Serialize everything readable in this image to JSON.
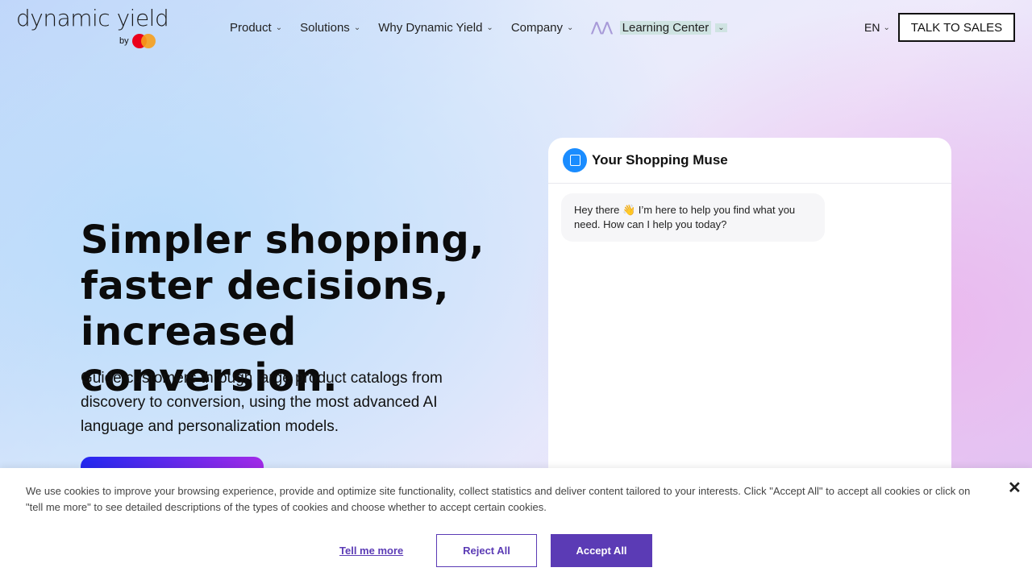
{
  "logo": {
    "name": "dynamic yield",
    "by": "by"
  },
  "nav": [
    {
      "label": "Product"
    },
    {
      "label": "Solutions"
    },
    {
      "label": "Why Dynamic Yield"
    },
    {
      "label": "Company"
    },
    {
      "label": "Learning Center"
    }
  ],
  "header": {
    "lang": "EN",
    "talk": "TALK TO SALES"
  },
  "hero": {
    "title": "Simpler shopping, faster decisions, increased conversion.",
    "subtitle": "Guide customers through large product catalogs from discovery to conversion, using the most advanced AI language and personalization models."
  },
  "chat": {
    "title": "Your Shopping Muse",
    "message": "Hey there 👋 I’m here to help you find what you need. How can I help you today?"
  },
  "cookie": {
    "text": "We use cookies to improve your browsing experience, provide and optimize site functionality, collect statistics and deliver content tailored to your interests. Click \"Accept All\" to accept all cookies or click on \"tell me more\" to see detailed descriptions of the types of cookies and choose whether to accept certain cookies.",
    "close": "✕",
    "tell": "Tell me more",
    "reject": "Reject All",
    "accept": "Accept All"
  },
  "colors": {
    "accent": "#5b3bb5",
    "bot": "#1a8cff"
  }
}
